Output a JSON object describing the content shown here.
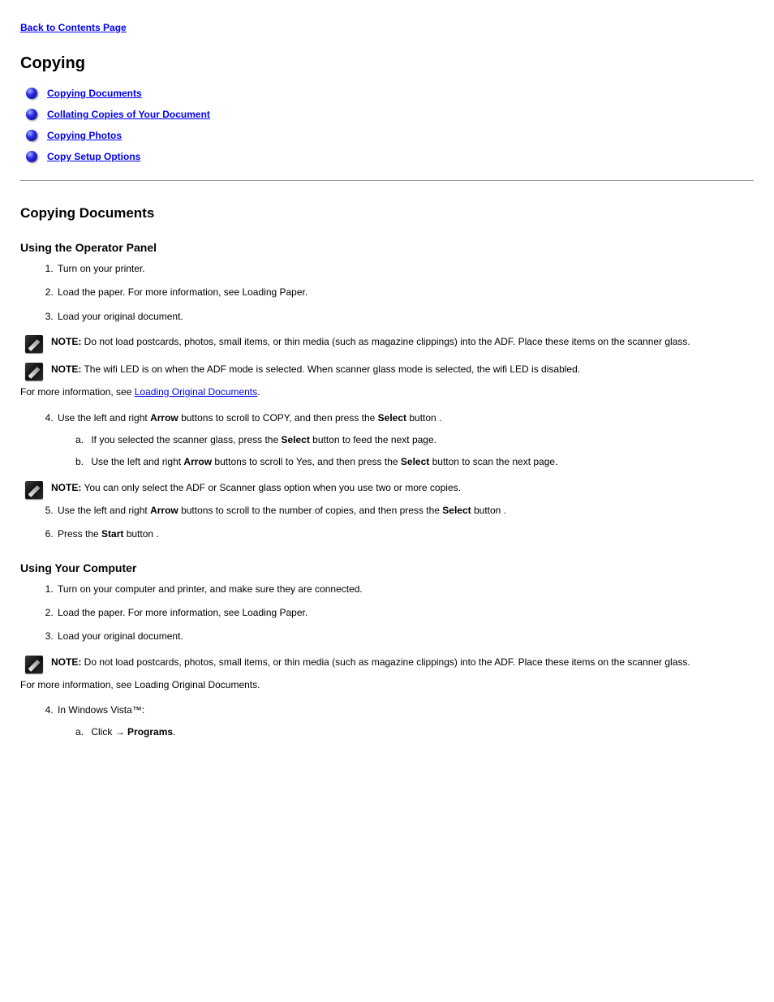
{
  "back_link": "Back to Contents Page",
  "title": "Copying",
  "toc": [
    "Copying Documents",
    "Collating Copies of Your Document",
    "Copying Photos",
    "Copy Setup Options"
  ],
  "sec1": {
    "heading": "Copying Documents",
    "sub1": "Using the Operator Panel",
    "steps1": [
      "Turn on your printer.",
      "Load the paper. For more information, see Loading Paper.",
      "Load your original document."
    ],
    "note1_label": "NOTE:",
    "note1_text": " Do not load postcards, photos, small items, or thin media (such as magazine clippings) into the ADF. Place these items on the scanner glass.",
    "note2_label": "NOTE:",
    "note2_text": " The wifi LED is on when the ADF mode is selected. When scanner glass mode is selected, the wifi LED is disabled.",
    "more_info_prefix": "For more information, see ",
    "more_info_link": "Loading Original Documents",
    "more_info_suffix": ".",
    "steps2_first": {
      "intro": "Use the left and right ",
      "arrow": "Arrow",
      "after_arrow": " buttons  to scroll to COPY, and then press the ",
      "select": "Select",
      "after_select": " button .",
      "sub_a": {
        "marker": "a.",
        "text_prefix": "If you selected the scanner glass, press the ",
        "select": "Select",
        "text_suffix": " button  to feed the next page."
      },
      "sub_b": {
        "marker": "b.",
        "text_prefix": "Use the left and right ",
        "arrow": "Arrow",
        "after_arrow": " buttons  to scroll to Yes, and then press the ",
        "select": "Select",
        "text_suffix": " button  to scan the next page."
      }
    },
    "note3_label": "NOTE:",
    "note3_text": " You can only select the ADF or Scanner glass option when you use two or more copies.",
    "steps2_second": {
      "intro": "Use the left and right ",
      "arrow": "Arrow",
      "after_arrow": " buttons  to scroll to the number of copies, and then press the ",
      "select": "Select",
      "after_select": " button ."
    },
    "last_step": {
      "prefix": "Press the ",
      "start": "Start",
      "suffix": " button ."
    },
    "sub2": "Using Your Computer",
    "steps_pc": [
      "Turn on your computer and printer, and make sure they are connected.",
      "Load the paper. For more information, see Loading Paper.",
      "Load your original document."
    ],
    "note4_label": "NOTE:",
    "note4_text": " Do not load postcards, photos, small items, or thin media (such as magazine clippings) into the ADF. Place these items on the scanner glass.",
    "more_info2_prefix": "For more information, see Loading Original Documents.",
    "steps_pc_4_a": "In Windows Vista™:",
    "steps_pc_4_a_sub": {
      "marker": "a.",
      "prefix": "Click ",
      "bold": "→ Programs",
      "suffix": "."
    }
  }
}
